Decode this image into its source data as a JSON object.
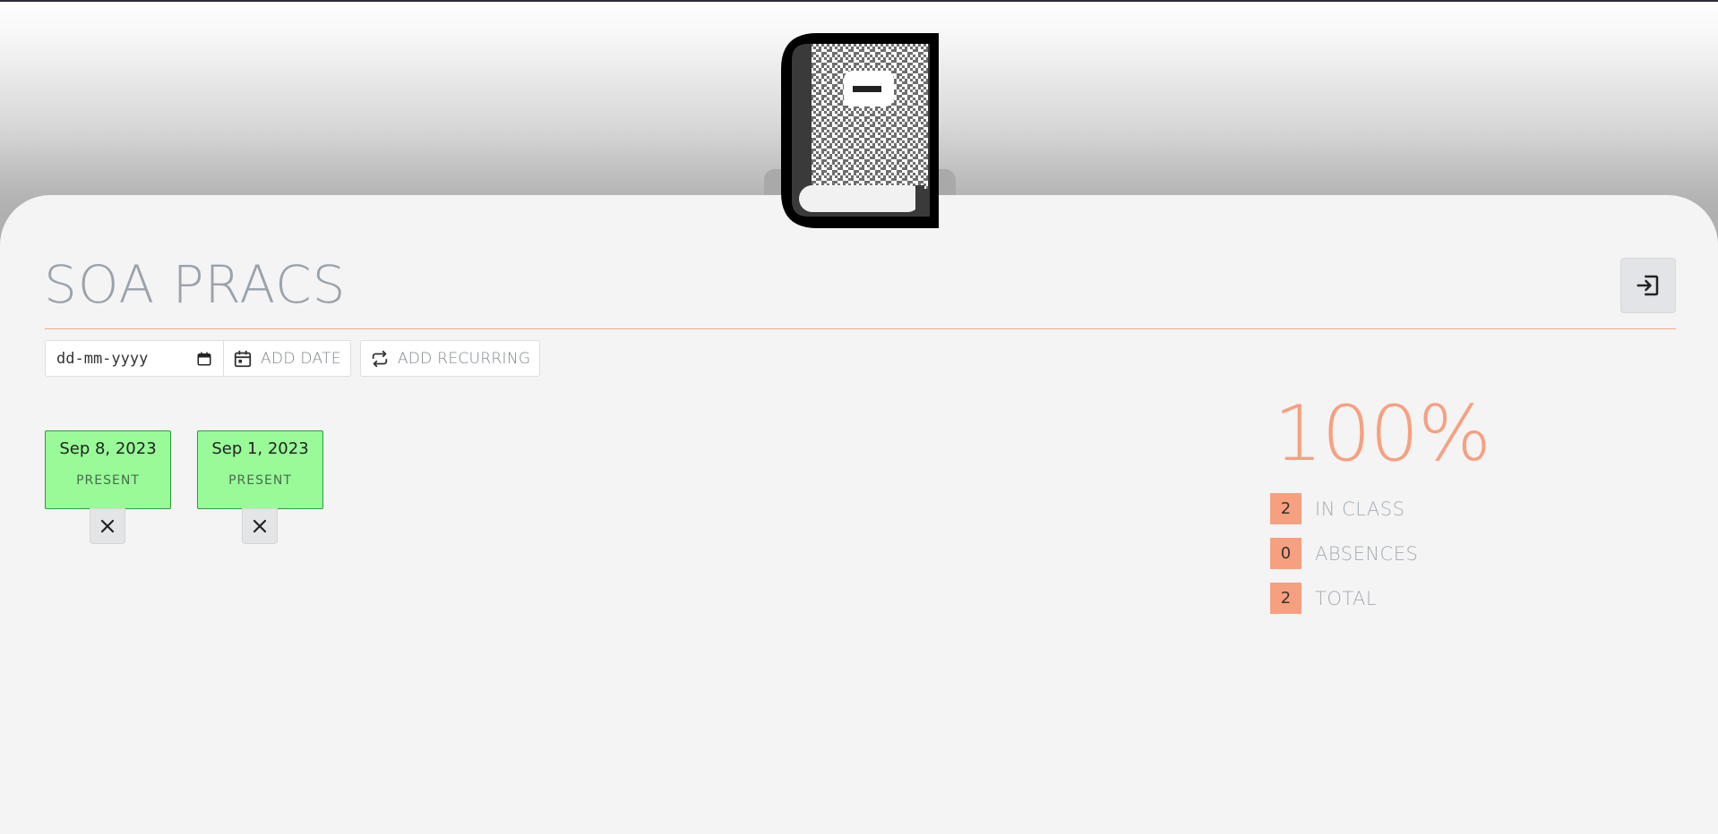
{
  "course": {
    "title": "SOA PRACS"
  },
  "icons": {
    "logo": "book-icon",
    "exit": "exit-icon",
    "calendar": "calendar-icon",
    "add_date": "calendar-add-icon",
    "recurring": "repeat-icon",
    "remove": "close-icon"
  },
  "toolbar": {
    "date_input_placeholder": "dd-mm-yyyy",
    "add_date_label": "ADD DATE",
    "add_recurring_label": "ADD RECURRING"
  },
  "attendance": [
    {
      "date": "Sep 8, 2023",
      "status": "PRESENT",
      "remove_label": "✕"
    },
    {
      "date": "Sep 1, 2023",
      "status": "PRESENT",
      "remove_label": "✕"
    }
  ],
  "stats": {
    "percent": "100%",
    "rows": [
      {
        "count": "2",
        "label": "IN CLASS"
      },
      {
        "count": "0",
        "label": "ABSENCES"
      },
      {
        "count": "2",
        "label": "TOTAL"
      }
    ]
  },
  "colors": {
    "accent": "#f7a07f",
    "present_bg": "#98fb98",
    "present_border": "#2e9a3e",
    "title_text": "#9aa2ab"
  }
}
